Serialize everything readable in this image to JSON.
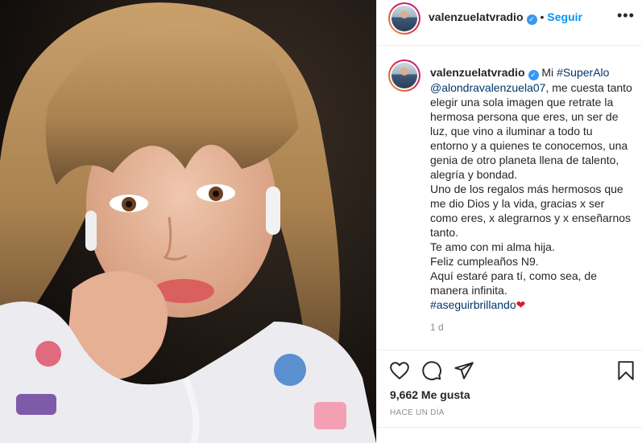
{
  "post": {
    "username": "valenzuelatvradio",
    "verified_mark": "✓",
    "dot": "•",
    "follow_label": "Seguir",
    "more_label": "•••",
    "caption": {
      "line1_prefix": "Mi ",
      "hashtag1": "#SuperAlo",
      "mention": "@alondravalenzuela07",
      "line1_suffix": ", me cuesta tanto elegir una sola imagen que retrate la hermosa persona que eres, un ser de luz, que vino a iluminar a todo tu entorno y a quienes te conocemos, una genia de otro planeta llena de talento, alegría y bondad.",
      "para2": "Uno de los regalos más hermosos que me dio Dios y la vida, gracias x ser como eres, x alegrarnos y x enseñarnos tanto.",
      "para3": "Te amo con mi alma hija.",
      "para4": "Feliz cumpleaños N9.",
      "para5": "Aquí estaré para tí, como sea, de manera infinita.",
      "hashtag2": "#aseguirbrillando",
      "heart": "❤"
    },
    "time_ago": "1 d",
    "likes_text": "9,662 Me gusta",
    "date_text": "HACE UN DÍA"
  },
  "icons": {
    "like": "heart-icon",
    "comment": "comment-icon",
    "share": "share-icon",
    "save": "bookmark-icon",
    "more": "more-options-icon"
  },
  "colors": {
    "link_blue": "#0095f6",
    "hashtag": "#00376b",
    "verified": "#3897f0",
    "heart": "#e0162b"
  }
}
